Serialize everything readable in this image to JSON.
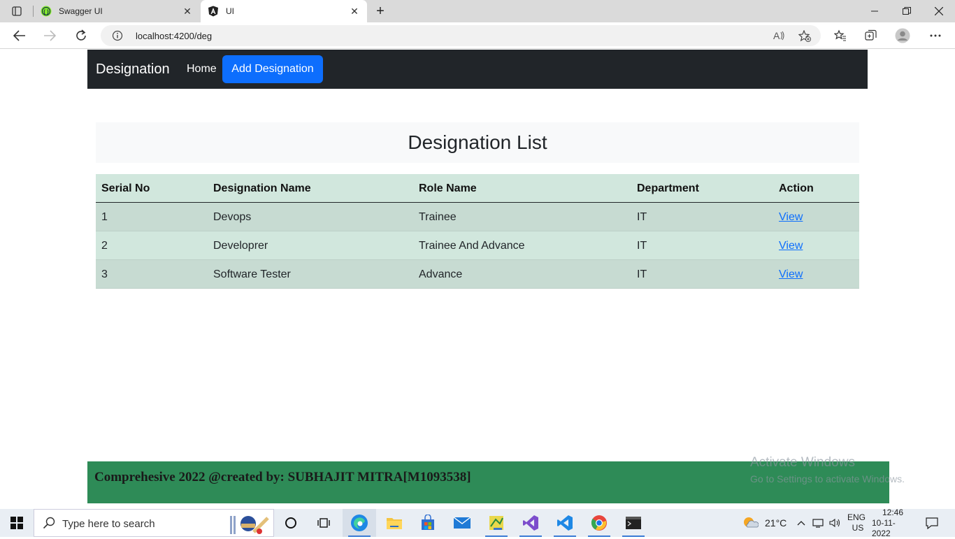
{
  "browser": {
    "tabs": [
      {
        "title": "Swagger UI",
        "favicon": "swagger-icon",
        "active": false
      },
      {
        "title": "UI",
        "favicon": "angular-icon",
        "active": true
      }
    ],
    "url": "localhost:4200/deg"
  },
  "app": {
    "brand": "Designation",
    "nav": {
      "home": "Home",
      "add": "Add Designation"
    },
    "heading": "Designation List",
    "table": {
      "headers": [
        "Serial No",
        "Designation Name",
        "Role Name",
        "Department",
        "Action"
      ],
      "rows": [
        {
          "serial": "1",
          "designation": "Devops",
          "role": "Trainee",
          "department": "IT",
          "action": "View"
        },
        {
          "serial": "2",
          "designation": "Developrer",
          "role": "Trainee And Advance",
          "department": "IT",
          "action": "View"
        },
        {
          "serial": "3",
          "designation": "Software Tester",
          "role": "Advance",
          "department": "IT",
          "action": "View"
        }
      ]
    },
    "footer": "Comprehesive 2022 @created by: SUBHAJIT MITRA[M1093538]"
  },
  "watermark": {
    "line1": "Activate Windows",
    "line2": "Go to Settings to activate Windows."
  },
  "taskbar": {
    "search_placeholder": "Type here to search",
    "weather": "21°C",
    "lang1": "ENG",
    "lang2": "US",
    "time": "12:46",
    "date": "10-11-2022"
  },
  "colors": {
    "navbar": "#212529",
    "primary": "#0d6efd",
    "table": "#d1e7dd",
    "footer": "#2e8b57"
  }
}
